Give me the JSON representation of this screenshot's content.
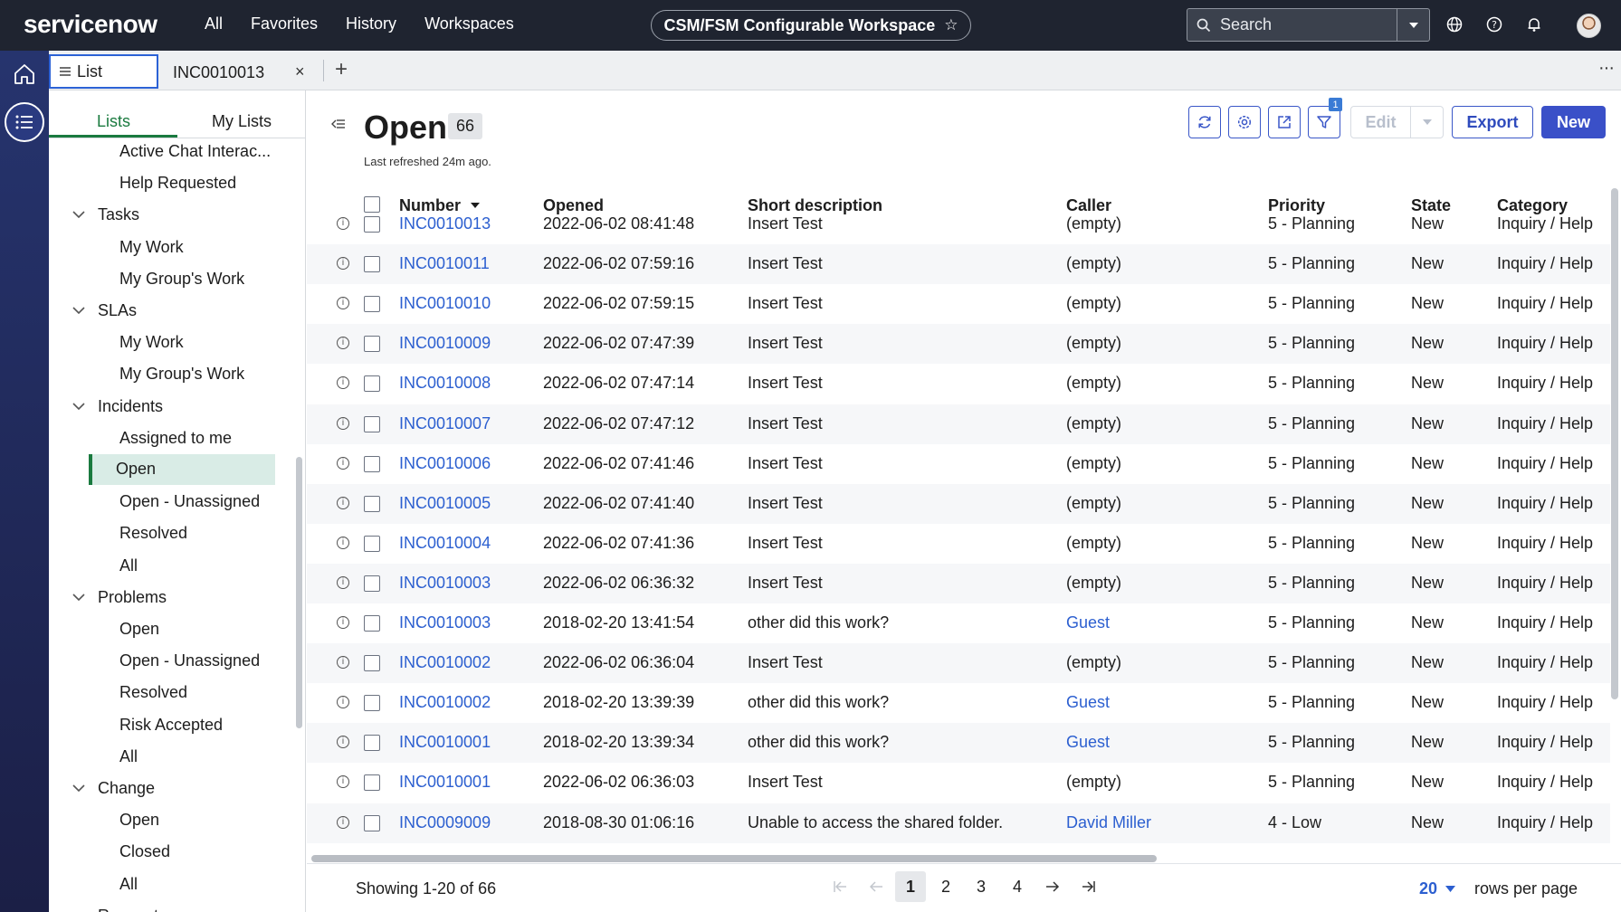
{
  "header": {
    "logo": "servicenow",
    "nav": [
      "All",
      "Favorites",
      "History",
      "Workspaces"
    ],
    "workspace": "CSM/FSM Configurable Workspace",
    "search_placeholder": "Search",
    "icons": [
      "globe-icon",
      "help-icon",
      "bell-icon"
    ]
  },
  "tabs": {
    "list_label": "List",
    "record_label": "INC0010013",
    "close_glyph": "×",
    "add_glyph": "+",
    "more_glyph": "···"
  },
  "navigator": {
    "tabs": [
      "Lists",
      "My Lists"
    ],
    "items": [
      {
        "label": "Active Chat Interac...",
        "level": 2
      },
      {
        "label": "Help Requested",
        "level": 2
      },
      {
        "label": "Tasks",
        "level": 1
      },
      {
        "label": "My Work",
        "level": 2
      },
      {
        "label": "My Group's Work",
        "level": 2
      },
      {
        "label": "SLAs",
        "level": 1
      },
      {
        "label": "My Work",
        "level": 2
      },
      {
        "label": "My Group's Work",
        "level": 2
      },
      {
        "label": "Incidents",
        "level": 1
      },
      {
        "label": "Assigned to me",
        "level": 2
      },
      {
        "label": "Open",
        "level": 2,
        "selected": true
      },
      {
        "label": "Open - Unassigned",
        "level": 2
      },
      {
        "label": "Resolved",
        "level": 2
      },
      {
        "label": "All",
        "level": 2
      },
      {
        "label": "Problems",
        "level": 1
      },
      {
        "label": "Open",
        "level": 2
      },
      {
        "label": "Open - Unassigned",
        "level": 2
      },
      {
        "label": "Resolved",
        "level": 2
      },
      {
        "label": "Risk Accepted",
        "level": 2
      },
      {
        "label": "All",
        "level": 2
      },
      {
        "label": "Change",
        "level": 1
      },
      {
        "label": "Open",
        "level": 2
      },
      {
        "label": "Closed",
        "level": 2
      },
      {
        "label": "All",
        "level": 2
      },
      {
        "label": "Requests",
        "level": 1
      }
    ]
  },
  "list": {
    "title": "Open",
    "count": "66",
    "refreshed": "Last refreshed 24m ago.",
    "filter_count": "1",
    "buttons": {
      "edit": "Edit",
      "export": "Export",
      "new": "New"
    },
    "columns": [
      "Number",
      "Opened",
      "Short description",
      "Caller",
      "Priority",
      "State",
      "Category"
    ],
    "rows": [
      {
        "number": "INC0010013",
        "opened": "2022-06-02 08:41:48",
        "desc": "Insert Test",
        "caller": "(empty)",
        "priority": "5 - Planning",
        "state": "New",
        "category": "Inquiry / Help"
      },
      {
        "number": "INC0010011",
        "opened": "2022-06-02 07:59:16",
        "desc": "Insert Test",
        "caller": "(empty)",
        "priority": "5 - Planning",
        "state": "New",
        "category": "Inquiry / Help"
      },
      {
        "number": "INC0010010",
        "opened": "2022-06-02 07:59:15",
        "desc": "Insert Test",
        "caller": "(empty)",
        "priority": "5 - Planning",
        "state": "New",
        "category": "Inquiry / Help"
      },
      {
        "number": "INC0010009",
        "opened": "2022-06-02 07:47:39",
        "desc": "Insert Test",
        "caller": "(empty)",
        "priority": "5 - Planning",
        "state": "New",
        "category": "Inquiry / Help"
      },
      {
        "number": "INC0010008",
        "opened": "2022-06-02 07:47:14",
        "desc": "Insert Test",
        "caller": "(empty)",
        "priority": "5 - Planning",
        "state": "New",
        "category": "Inquiry / Help"
      },
      {
        "number": "INC0010007",
        "opened": "2022-06-02 07:47:12",
        "desc": "Insert Test",
        "caller": "(empty)",
        "priority": "5 - Planning",
        "state": "New",
        "category": "Inquiry / Help"
      },
      {
        "number": "INC0010006",
        "opened": "2022-06-02 07:41:46",
        "desc": "Insert Test",
        "caller": "(empty)",
        "priority": "5 - Planning",
        "state": "New",
        "category": "Inquiry / Help"
      },
      {
        "number": "INC0010005",
        "opened": "2022-06-02 07:41:40",
        "desc": "Insert Test",
        "caller": "(empty)",
        "priority": "5 - Planning",
        "state": "New",
        "category": "Inquiry / Help"
      },
      {
        "number": "INC0010004",
        "opened": "2022-06-02 07:41:36",
        "desc": "Insert Test",
        "caller": "(empty)",
        "priority": "5 - Planning",
        "state": "New",
        "category": "Inquiry / Help"
      },
      {
        "number": "INC0010003",
        "opened": "2022-06-02 06:36:32",
        "desc": "Insert Test",
        "caller": "(empty)",
        "priority": "5 - Planning",
        "state": "New",
        "category": "Inquiry / Help"
      },
      {
        "number": "INC0010003",
        "opened": "2018-02-20 13:41:54",
        "desc": "other did this work?",
        "caller": "Guest",
        "priority": "5 - Planning",
        "state": "New",
        "category": "Inquiry / Help"
      },
      {
        "number": "INC0010002",
        "opened": "2022-06-02 06:36:04",
        "desc": "Insert Test",
        "caller": "(empty)",
        "priority": "5 - Planning",
        "state": "New",
        "category": "Inquiry / Help"
      },
      {
        "number": "INC0010002",
        "opened": "2018-02-20 13:39:39",
        "desc": "other did this work?",
        "caller": "Guest",
        "priority": "5 - Planning",
        "state": "New",
        "category": "Inquiry / Help"
      },
      {
        "number": "INC0010001",
        "opened": "2018-02-20 13:39:34",
        "desc": "other did this work?",
        "caller": "Guest",
        "priority": "5 - Planning",
        "state": "New",
        "category": "Inquiry / Help"
      },
      {
        "number": "INC0010001",
        "opened": "2022-06-02 06:36:03",
        "desc": "Insert Test",
        "caller": "(empty)",
        "priority": "5 - Planning",
        "state": "New",
        "category": "Inquiry / Help"
      },
      {
        "number": "INC0009009",
        "opened": "2018-08-30 01:06:16",
        "desc": "Unable to access the shared folder.",
        "caller": "David Miller",
        "priority": "4 - Low",
        "state": "New",
        "category": "Inquiry / Help"
      }
    ]
  },
  "footer": {
    "showing": "Showing 1-20 of 66",
    "pages": [
      "1",
      "2",
      "3",
      "4"
    ],
    "current_page": "1",
    "rows_per_page": "20",
    "rows_per_page_label": "rows per page"
  },
  "colors": {
    "accent": "#3a50c8",
    "link": "#2c5fd0",
    "nav_active": "#1a7a3f",
    "header_bg": "#1f2430"
  }
}
